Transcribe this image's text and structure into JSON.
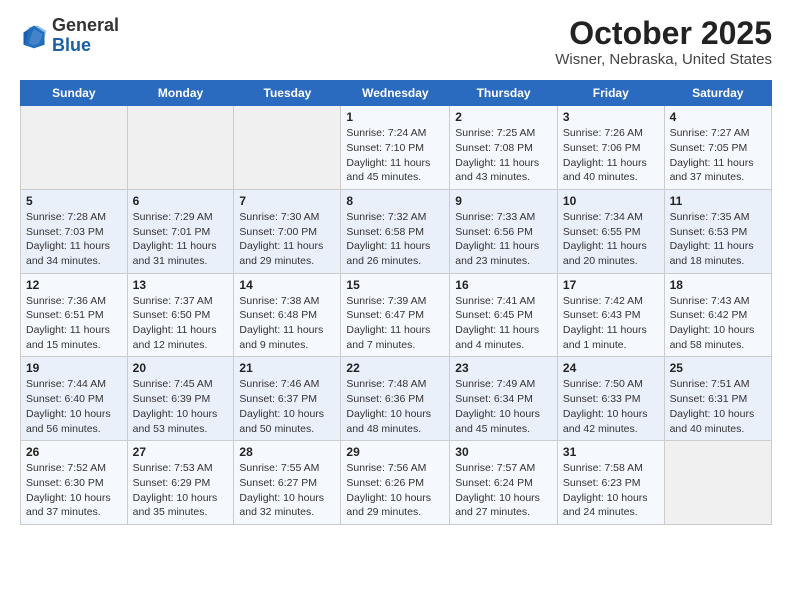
{
  "header": {
    "logo_general": "General",
    "logo_blue": "Blue",
    "title": "October 2025",
    "subtitle": "Wisner, Nebraska, United States"
  },
  "days_of_week": [
    "Sunday",
    "Monday",
    "Tuesday",
    "Wednesday",
    "Thursday",
    "Friday",
    "Saturday"
  ],
  "weeks": [
    [
      {
        "day": "",
        "sunrise": "",
        "sunset": "",
        "daylight": ""
      },
      {
        "day": "",
        "sunrise": "",
        "sunset": "",
        "daylight": ""
      },
      {
        "day": "",
        "sunrise": "",
        "sunset": "",
        "daylight": ""
      },
      {
        "day": "1",
        "sunrise": "Sunrise: 7:24 AM",
        "sunset": "Sunset: 7:10 PM",
        "daylight": "Daylight: 11 hours and 45 minutes."
      },
      {
        "day": "2",
        "sunrise": "Sunrise: 7:25 AM",
        "sunset": "Sunset: 7:08 PM",
        "daylight": "Daylight: 11 hours and 43 minutes."
      },
      {
        "day": "3",
        "sunrise": "Sunrise: 7:26 AM",
        "sunset": "Sunset: 7:06 PM",
        "daylight": "Daylight: 11 hours and 40 minutes."
      },
      {
        "day": "4",
        "sunrise": "Sunrise: 7:27 AM",
        "sunset": "Sunset: 7:05 PM",
        "daylight": "Daylight: 11 hours and 37 minutes."
      }
    ],
    [
      {
        "day": "5",
        "sunrise": "Sunrise: 7:28 AM",
        "sunset": "Sunset: 7:03 PM",
        "daylight": "Daylight: 11 hours and 34 minutes."
      },
      {
        "day": "6",
        "sunrise": "Sunrise: 7:29 AM",
        "sunset": "Sunset: 7:01 PM",
        "daylight": "Daylight: 11 hours and 31 minutes."
      },
      {
        "day": "7",
        "sunrise": "Sunrise: 7:30 AM",
        "sunset": "Sunset: 7:00 PM",
        "daylight": "Daylight: 11 hours and 29 minutes."
      },
      {
        "day": "8",
        "sunrise": "Sunrise: 7:32 AM",
        "sunset": "Sunset: 6:58 PM",
        "daylight": "Daylight: 11 hours and 26 minutes."
      },
      {
        "day": "9",
        "sunrise": "Sunrise: 7:33 AM",
        "sunset": "Sunset: 6:56 PM",
        "daylight": "Daylight: 11 hours and 23 minutes."
      },
      {
        "day": "10",
        "sunrise": "Sunrise: 7:34 AM",
        "sunset": "Sunset: 6:55 PM",
        "daylight": "Daylight: 11 hours and 20 minutes."
      },
      {
        "day": "11",
        "sunrise": "Sunrise: 7:35 AM",
        "sunset": "Sunset: 6:53 PM",
        "daylight": "Daylight: 11 hours and 18 minutes."
      }
    ],
    [
      {
        "day": "12",
        "sunrise": "Sunrise: 7:36 AM",
        "sunset": "Sunset: 6:51 PM",
        "daylight": "Daylight: 11 hours and 15 minutes."
      },
      {
        "day": "13",
        "sunrise": "Sunrise: 7:37 AM",
        "sunset": "Sunset: 6:50 PM",
        "daylight": "Daylight: 11 hours and 12 minutes."
      },
      {
        "day": "14",
        "sunrise": "Sunrise: 7:38 AM",
        "sunset": "Sunset: 6:48 PM",
        "daylight": "Daylight: 11 hours and 9 minutes."
      },
      {
        "day": "15",
        "sunrise": "Sunrise: 7:39 AM",
        "sunset": "Sunset: 6:47 PM",
        "daylight": "Daylight: 11 hours and 7 minutes."
      },
      {
        "day": "16",
        "sunrise": "Sunrise: 7:41 AM",
        "sunset": "Sunset: 6:45 PM",
        "daylight": "Daylight: 11 hours and 4 minutes."
      },
      {
        "day": "17",
        "sunrise": "Sunrise: 7:42 AM",
        "sunset": "Sunset: 6:43 PM",
        "daylight": "Daylight: 11 hours and 1 minute."
      },
      {
        "day": "18",
        "sunrise": "Sunrise: 7:43 AM",
        "sunset": "Sunset: 6:42 PM",
        "daylight": "Daylight: 10 hours and 58 minutes."
      }
    ],
    [
      {
        "day": "19",
        "sunrise": "Sunrise: 7:44 AM",
        "sunset": "Sunset: 6:40 PM",
        "daylight": "Daylight: 10 hours and 56 minutes."
      },
      {
        "day": "20",
        "sunrise": "Sunrise: 7:45 AM",
        "sunset": "Sunset: 6:39 PM",
        "daylight": "Daylight: 10 hours and 53 minutes."
      },
      {
        "day": "21",
        "sunrise": "Sunrise: 7:46 AM",
        "sunset": "Sunset: 6:37 PM",
        "daylight": "Daylight: 10 hours and 50 minutes."
      },
      {
        "day": "22",
        "sunrise": "Sunrise: 7:48 AM",
        "sunset": "Sunset: 6:36 PM",
        "daylight": "Daylight: 10 hours and 48 minutes."
      },
      {
        "day": "23",
        "sunrise": "Sunrise: 7:49 AM",
        "sunset": "Sunset: 6:34 PM",
        "daylight": "Daylight: 10 hours and 45 minutes."
      },
      {
        "day": "24",
        "sunrise": "Sunrise: 7:50 AM",
        "sunset": "Sunset: 6:33 PM",
        "daylight": "Daylight: 10 hours and 42 minutes."
      },
      {
        "day": "25",
        "sunrise": "Sunrise: 7:51 AM",
        "sunset": "Sunset: 6:31 PM",
        "daylight": "Daylight: 10 hours and 40 minutes."
      }
    ],
    [
      {
        "day": "26",
        "sunrise": "Sunrise: 7:52 AM",
        "sunset": "Sunset: 6:30 PM",
        "daylight": "Daylight: 10 hours and 37 minutes."
      },
      {
        "day": "27",
        "sunrise": "Sunrise: 7:53 AM",
        "sunset": "Sunset: 6:29 PM",
        "daylight": "Daylight: 10 hours and 35 minutes."
      },
      {
        "day": "28",
        "sunrise": "Sunrise: 7:55 AM",
        "sunset": "Sunset: 6:27 PM",
        "daylight": "Daylight: 10 hours and 32 minutes."
      },
      {
        "day": "29",
        "sunrise": "Sunrise: 7:56 AM",
        "sunset": "Sunset: 6:26 PM",
        "daylight": "Daylight: 10 hours and 29 minutes."
      },
      {
        "day": "30",
        "sunrise": "Sunrise: 7:57 AM",
        "sunset": "Sunset: 6:24 PM",
        "daylight": "Daylight: 10 hours and 27 minutes."
      },
      {
        "day": "31",
        "sunrise": "Sunrise: 7:58 AM",
        "sunset": "Sunset: 6:23 PM",
        "daylight": "Daylight: 10 hours and 24 minutes."
      },
      {
        "day": "",
        "sunrise": "",
        "sunset": "",
        "daylight": ""
      }
    ]
  ]
}
